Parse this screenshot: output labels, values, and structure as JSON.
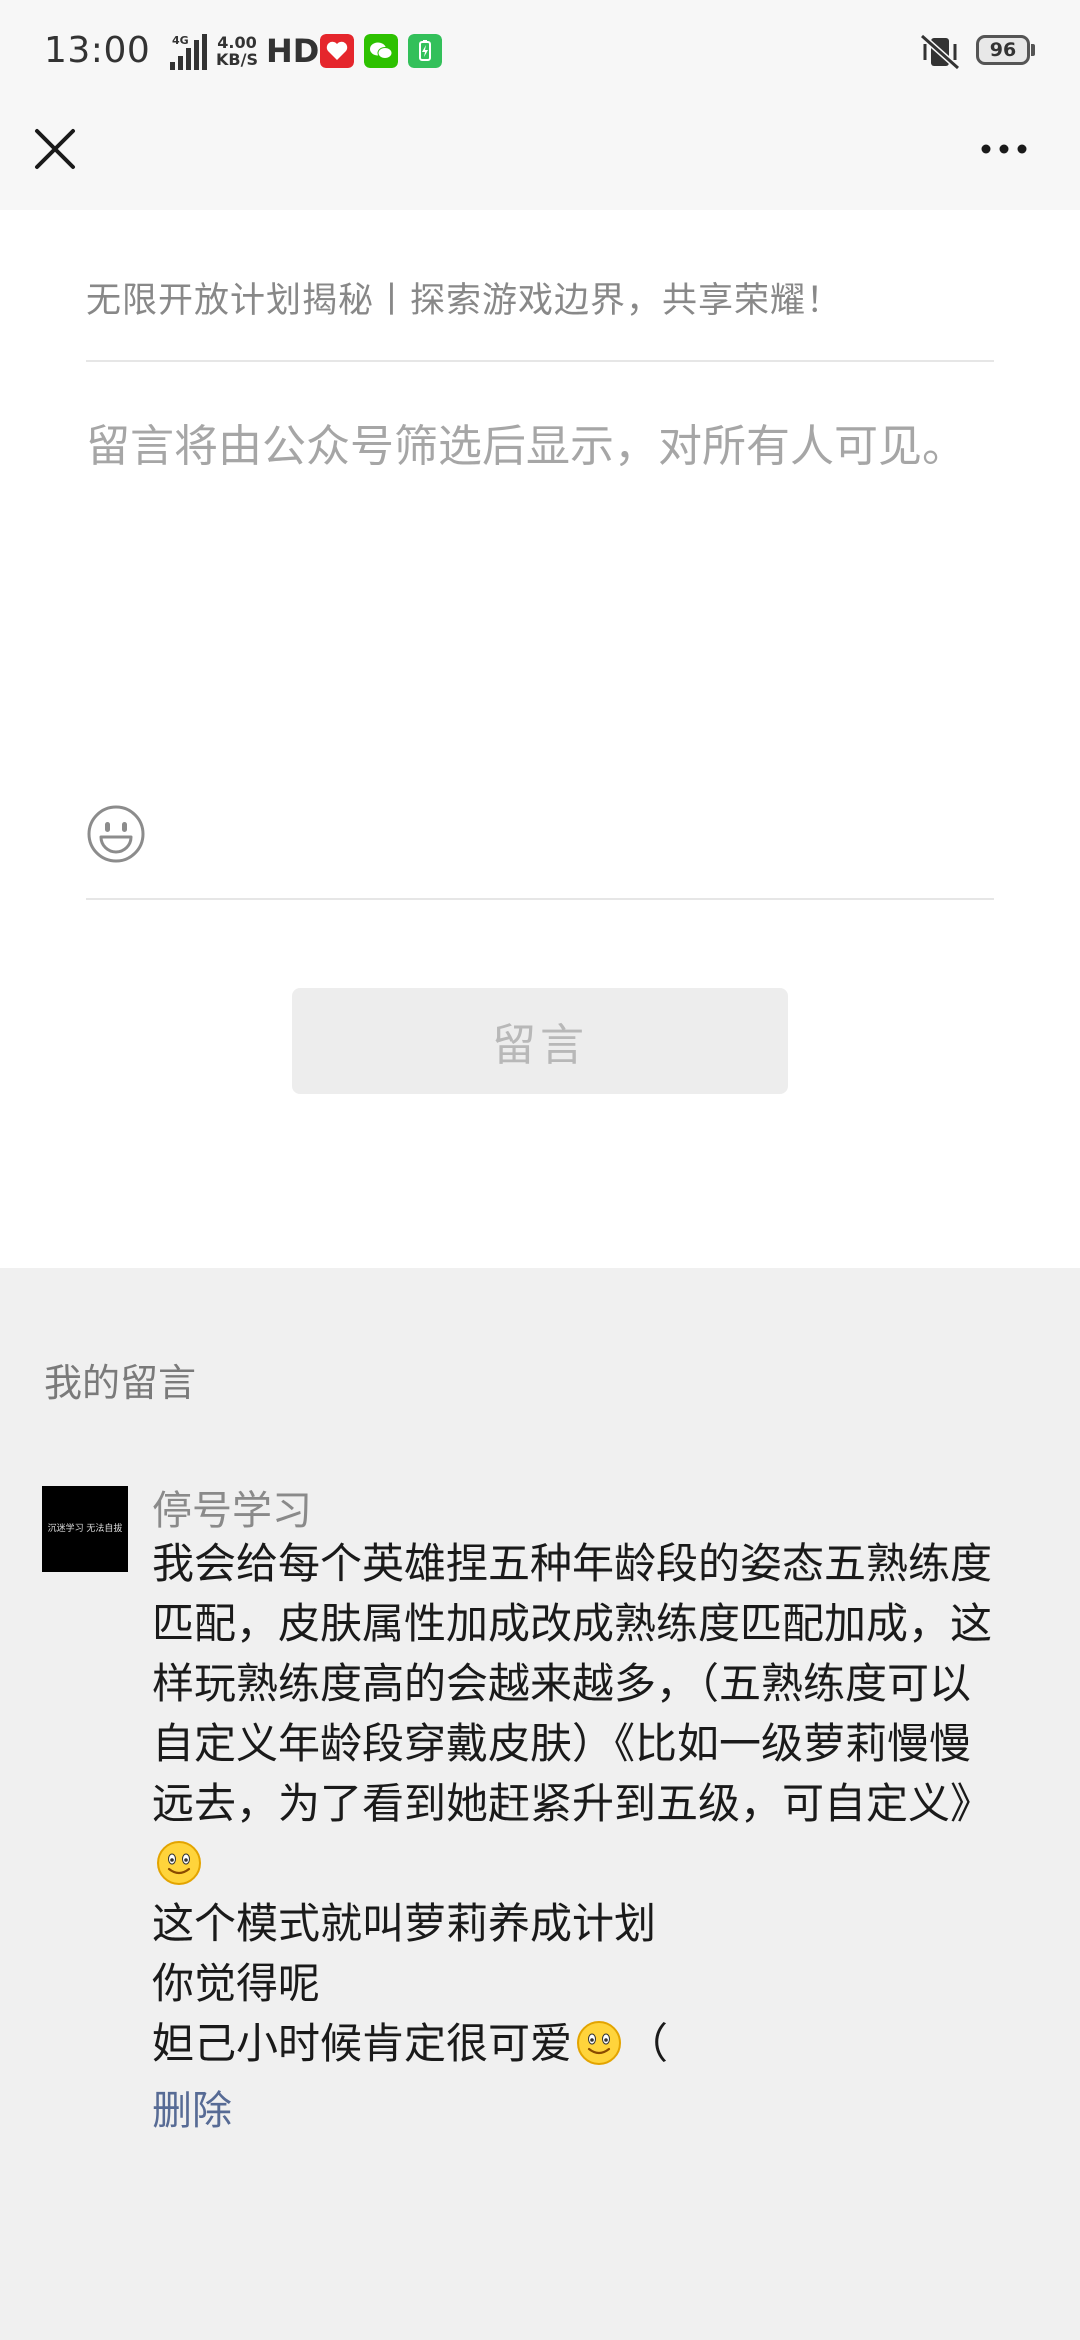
{
  "status_bar": {
    "time": "13:00",
    "network": "4G",
    "speed_value": "4.00",
    "speed_unit": "KB/S",
    "hd": "HD",
    "battery": "96"
  },
  "nav": {
    "close_icon": "close-icon",
    "more_icon": "more-dots-icon"
  },
  "compose": {
    "article_title": "无限开放计划揭秘丨探索游戏边界，共享荣耀！",
    "placeholder": "留言将由公众号筛选后显示，对所有人可见。",
    "emoji_icon": "smiley-face-icon",
    "submit_label": "留言"
  },
  "my_comments": {
    "section_title": "我的留言",
    "items": [
      {
        "author": "停号学习",
        "avatar_text": "沉迷学习 无法自拔",
        "lines": [
          "我会给每个英雄捏五种年龄段的姿态五熟练度匹配，皮肤属性加成改成熟练度匹配加成，这样玩熟练度高的会越来越多，（五熟练度可以自定义年龄段穿戴皮肤）《比如一级萝莉慢慢远去，为了看到她赶紧升到五级，可自定义》",
          "这个模式就叫萝莉养成计划",
          "你觉得呢",
          "妲己小时候肯定很可爱",
          "（"
        ],
        "delete_label": "删除"
      }
    ]
  },
  "colors": {
    "link": "#576b95",
    "section_bg": "#f0f0f0",
    "button_bg": "#ededed"
  }
}
